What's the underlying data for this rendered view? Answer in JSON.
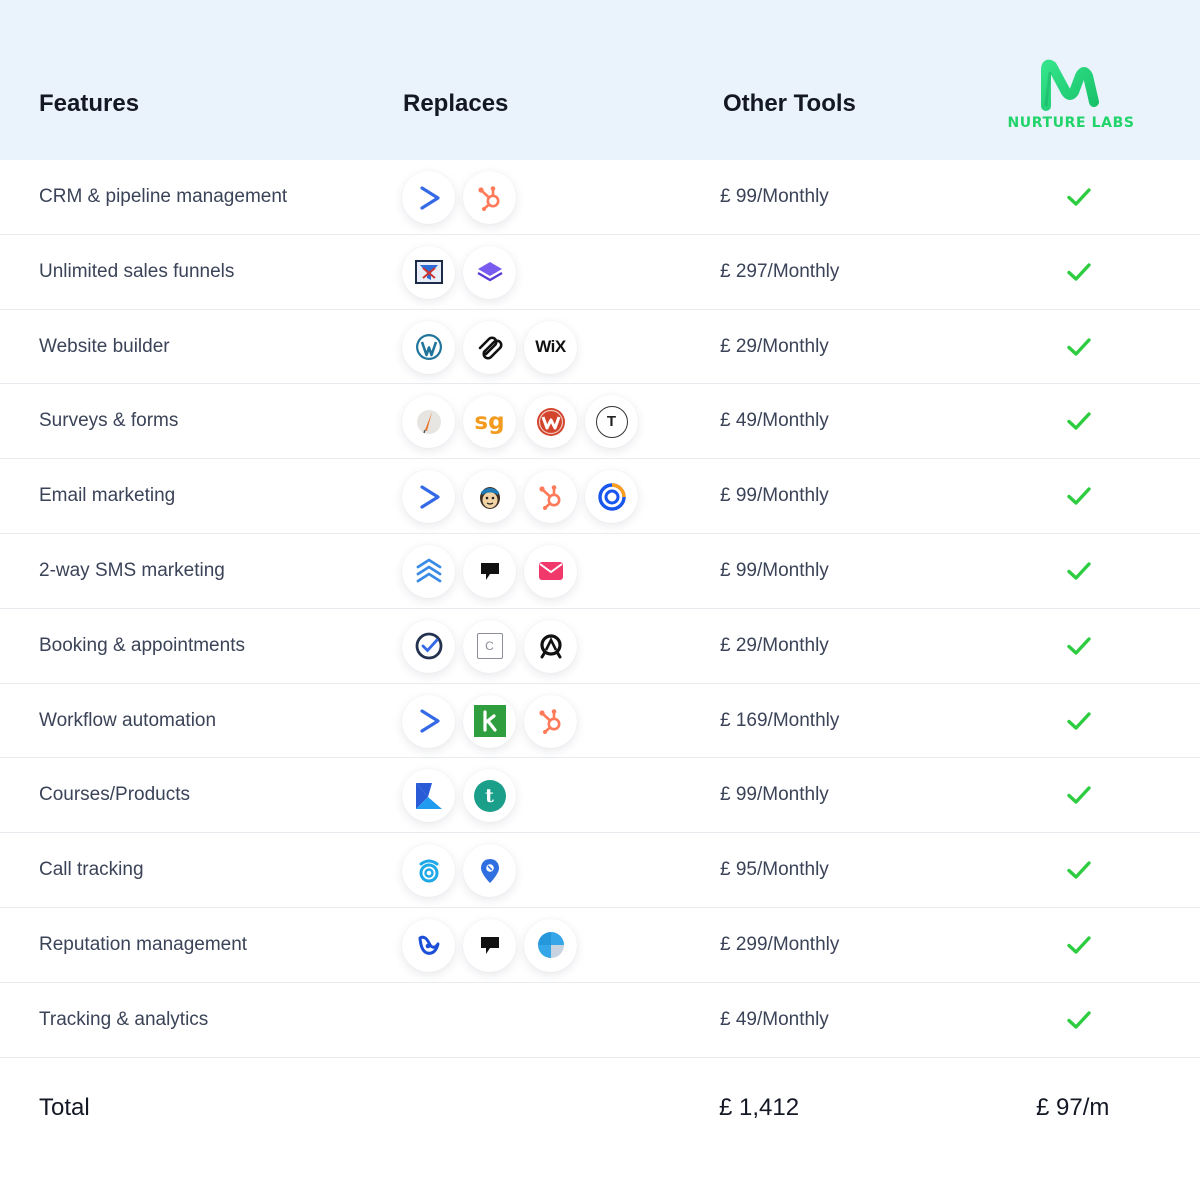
{
  "header": {
    "features": "Features",
    "replaces": "Replaces",
    "other_tools": "Other Tools",
    "brand": "NURTURE LABS"
  },
  "colors": {
    "header_bg": "#eaf2fc",
    "brand_green": "#21d46a",
    "check_green": "#2ecc40",
    "text": "#3b4358"
  },
  "rows": [
    {
      "feature": "CRM & pipeline management",
      "price": "£ 99/Monthly",
      "icons": [
        "activecampaign-icon",
        "hubspot-icon"
      ]
    },
    {
      "feature": "Unlimited sales funnels",
      "price": "£ 297/Monthly",
      "icons": [
        "clickfunnels-icon",
        "layers-icon"
      ]
    },
    {
      "feature": "Website builder",
      "price": "£ 29/Monthly",
      "icons": [
        "wordpress-icon",
        "squarespace-icon",
        "wix-icon"
      ]
    },
    {
      "feature": "Surveys & forms",
      "price": "£ 49/Monthly",
      "icons": [
        "feather-pen-icon",
        "surveygizmo-icon",
        "wufoo-icon",
        "typeform-icon"
      ]
    },
    {
      "feature": "Email marketing",
      "price": "£ 99/Monthly",
      "icons": [
        "activecampaign-icon",
        "mailchimp-icon",
        "hubspot-icon",
        "constant-contact-icon"
      ]
    },
    {
      "feature": "2-way SMS marketing",
      "price": "£ 99/Monthly",
      "icons": [
        "chevrons-stack-icon",
        "podium-icon",
        "mail-envelope-icon"
      ]
    },
    {
      "feature": "Booking & appointments",
      "price": "£ 29/Monthly",
      "icons": [
        "check-circle-icon",
        "calendar-icon",
        "acuity-icon"
      ]
    },
    {
      "feature": "Workflow automation",
      "price": "£ 169/Monthly",
      "icons": [
        "activecampaign-icon",
        "keap-icon",
        "hubspot-icon"
      ]
    },
    {
      "feature": "Courses/Products",
      "price": "£ 99/Monthly",
      "icons": [
        "kajabi-icon",
        "teachable-icon"
      ]
    },
    {
      "feature": "Call tracking",
      "price": "£ 95/Monthly",
      "icons": [
        "callrail-icon",
        "location-pin-icon"
      ]
    },
    {
      "feature": "Reputation management",
      "price": "£ 299/Monthly",
      "icons": [
        "birdeye-icon",
        "podium-icon",
        "yext-icon"
      ]
    },
    {
      "feature": "Tracking & analytics",
      "price": "£ 49/Monthly",
      "icons": []
    }
  ],
  "total": {
    "label": "Total",
    "other_tools": "£ 1,412",
    "nurture_labs": "£ 97/m"
  },
  "icon_text": {
    "wix": "WiX",
    "surveygizmo": "sg",
    "typeform": "T",
    "calendar": "C",
    "teachable": "t"
  }
}
